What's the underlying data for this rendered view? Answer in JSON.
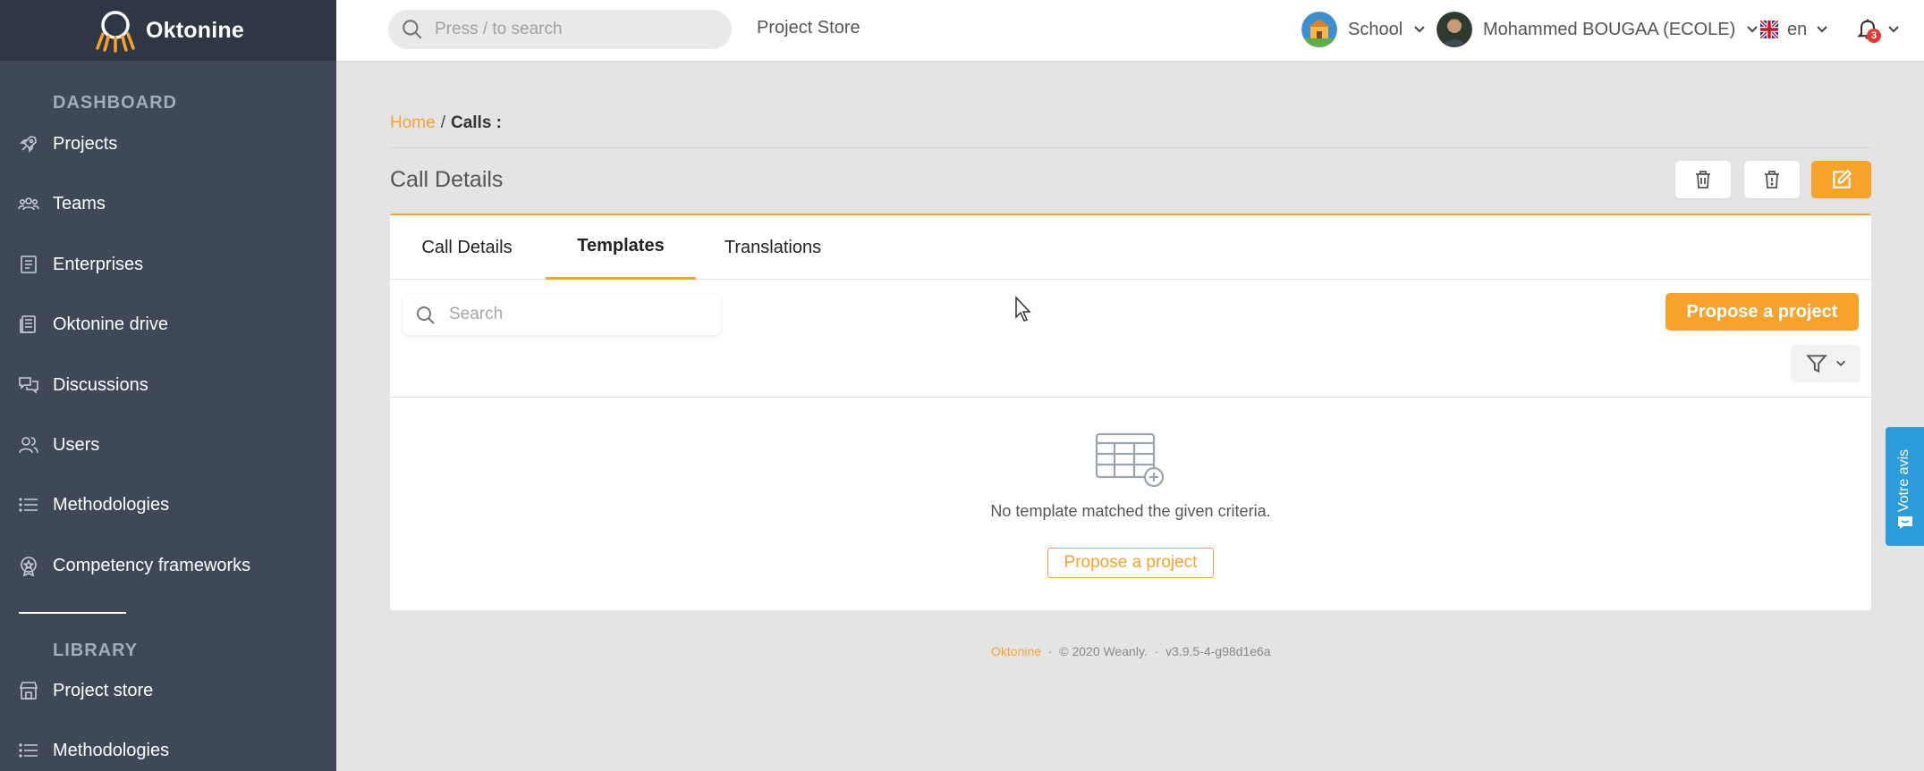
{
  "app": {
    "name": "Oktonine"
  },
  "sidebar": {
    "dashboard_title": "DASHBOARD",
    "dashboard_items": [
      {
        "label": "Projects",
        "icon": "rocket-icon"
      },
      {
        "label": "Teams",
        "icon": "team-icon"
      },
      {
        "label": "Enterprises",
        "icon": "enterprise-icon"
      },
      {
        "label": "Oktonine drive",
        "icon": "drive-icon"
      },
      {
        "label": "Discussions",
        "icon": "discussions-icon"
      },
      {
        "label": "Users",
        "icon": "users-icon"
      },
      {
        "label": "Methodologies",
        "icon": "list-icon"
      },
      {
        "label": "Competency frameworks",
        "icon": "badge-icon"
      }
    ],
    "library_title": "LIBRARY",
    "library_items": [
      {
        "label": "Project store",
        "icon": "store-icon"
      },
      {
        "label": "Methodologies",
        "icon": "list-icon"
      }
    ]
  },
  "topbar": {
    "search_placeholder": "Press / to search",
    "project_store_link": "Project Store",
    "school_label": "School",
    "user_name": "Mohammed BOUGAA (ECOLE)",
    "language": "en",
    "notification_count": "3"
  },
  "breadcrumb": {
    "home": "Home",
    "separator": "/",
    "current": "Calls :"
  },
  "page": {
    "title": "Call Details"
  },
  "tabs": [
    {
      "label": "Call Details",
      "active": false
    },
    {
      "label": "Templates",
      "active": true
    },
    {
      "label": "Translations",
      "active": false
    }
  ],
  "templates_panel": {
    "search_placeholder": "Search",
    "propose_button": "Propose a project",
    "empty_message": "No template matched the given criteria.",
    "empty_action": "Propose a project"
  },
  "footer": {
    "brand": "Oktonine",
    "dot": "·",
    "copyright": "© 2020 Weanly.",
    "version": "v3.9.5-4-g98d1e6a"
  },
  "feedback": {
    "label": "Votre avis"
  },
  "colors": {
    "accent": "#f6a32c",
    "sidebar": "#3f4856",
    "sidebar_header": "#2f3744",
    "feedback": "#2d9cdb"
  }
}
